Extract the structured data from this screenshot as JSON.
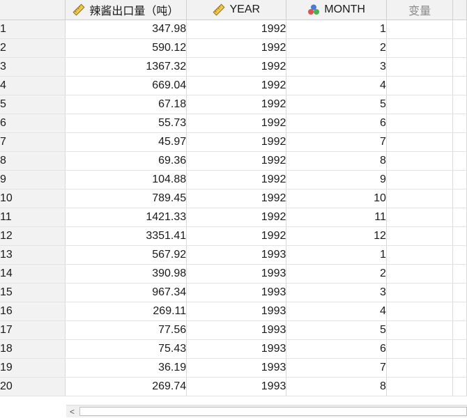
{
  "columns": [
    {
      "label": "辣酱出口量（吨）",
      "icon": "ruler-icon"
    },
    {
      "label": "YEAR",
      "icon": "ruler-icon"
    },
    {
      "label": "MONTH",
      "icon": "nominal-icon"
    },
    {
      "label": "变量"
    }
  ],
  "rows": [
    {
      "n": "1",
      "sauce": "347.98",
      "year": "1992",
      "month": "1"
    },
    {
      "n": "2",
      "sauce": "590.12",
      "year": "1992",
      "month": "2"
    },
    {
      "n": "3",
      "sauce": "1367.32",
      "year": "1992",
      "month": "3"
    },
    {
      "n": "4",
      "sauce": "669.04",
      "year": "1992",
      "month": "4"
    },
    {
      "n": "5",
      "sauce": "67.18",
      "year": "1992",
      "month": "5"
    },
    {
      "n": "6",
      "sauce": "55.73",
      "year": "1992",
      "month": "6"
    },
    {
      "n": "7",
      "sauce": "45.97",
      "year": "1992",
      "month": "7"
    },
    {
      "n": "8",
      "sauce": "69.36",
      "year": "1992",
      "month": "8"
    },
    {
      "n": "9",
      "sauce": "104.88",
      "year": "1992",
      "month": "9"
    },
    {
      "n": "10",
      "sauce": "789.45",
      "year": "1992",
      "month": "10"
    },
    {
      "n": "11",
      "sauce": "1421.33",
      "year": "1992",
      "month": "11"
    },
    {
      "n": "12",
      "sauce": "3351.41",
      "year": "1992",
      "month": "12"
    },
    {
      "n": "13",
      "sauce": "567.92",
      "year": "1993",
      "month": "1"
    },
    {
      "n": "14",
      "sauce": "390.98",
      "year": "1993",
      "month": "2"
    },
    {
      "n": "15",
      "sauce": "967.34",
      "year": "1993",
      "month": "3"
    },
    {
      "n": "16",
      "sauce": "269.11",
      "year": "1993",
      "month": "4"
    },
    {
      "n": "17",
      "sauce": "77.56",
      "year": "1993",
      "month": "5"
    },
    {
      "n": "18",
      "sauce": "75.43",
      "year": "1993",
      "month": "6"
    },
    {
      "n": "19",
      "sauce": "36.19",
      "year": "1993",
      "month": "7"
    },
    {
      "n": "20",
      "sauce": "269.74",
      "year": "1993",
      "month": "8"
    }
  ],
  "scrollbar": {
    "left_arrow": "<"
  }
}
